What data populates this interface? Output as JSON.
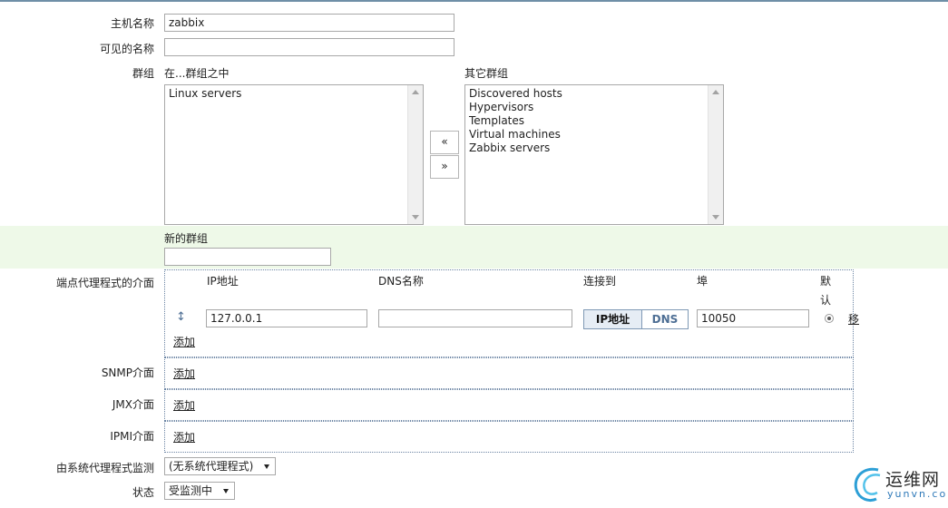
{
  "form": {
    "host_name": {
      "label": "主机名称",
      "value": "zabbix"
    },
    "visible_name": {
      "label": "可见的名称",
      "value": ""
    },
    "groups": {
      "label": "群组",
      "in_groups_label": "在...群组之中",
      "other_groups_label": "其它群组",
      "in_groups": [
        "Linux servers"
      ],
      "other_groups": [
        "Discovered hosts",
        "Hypervisors",
        "Templates",
        "Virtual machines",
        "Zabbix servers"
      ],
      "move_left": "«",
      "move_right": "»"
    },
    "new_group": {
      "label": "新的群组",
      "value": ""
    },
    "agent_interfaces": {
      "label": "端点代理程式的介面",
      "headers": {
        "ip": "IP地址",
        "dns": "DNS名称",
        "connect_to": "连接到",
        "port": "埠",
        "default_line1": "默",
        "default_line2": "认"
      },
      "row": {
        "drag_glyph": "↕",
        "ip": "127.0.0.1",
        "dns": "",
        "connect_ip": "IP地址",
        "connect_dns": "DNS",
        "port": "10050",
        "remove": "移"
      },
      "add": "添加"
    },
    "snmp": {
      "label": "SNMP介面",
      "add": "添加"
    },
    "jmx": {
      "label": "JMX介面",
      "add": "添加"
    },
    "ipmi": {
      "label": "IPMI介面",
      "add": "添加"
    },
    "proxy": {
      "label": "由系统代理程式监测",
      "value": "(无系统代理程式)"
    },
    "status": {
      "label": "状态",
      "value": "受监测中"
    }
  },
  "watermark": {
    "name": "运维网",
    "url": "yunvn.com"
  },
  "colors": {
    "accent": "#6b84a3",
    "green_band": "#eef9e8",
    "link_blue": "#2d78b8"
  }
}
